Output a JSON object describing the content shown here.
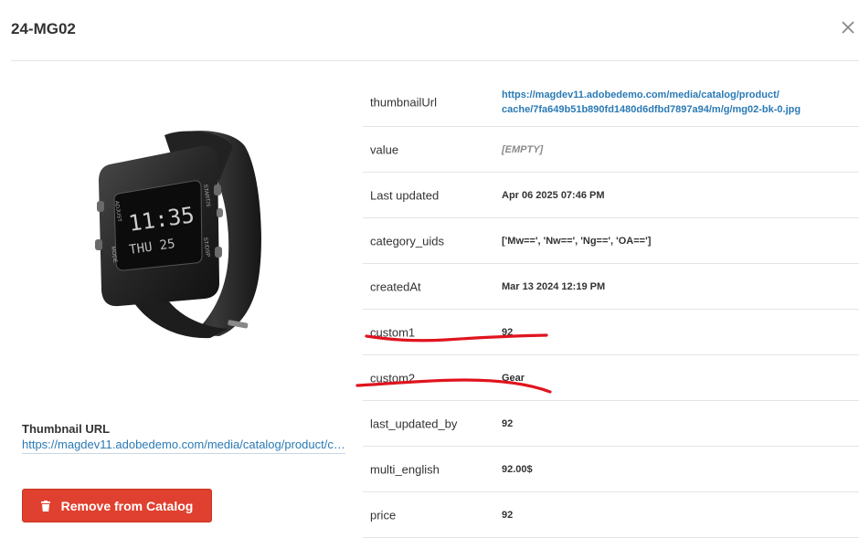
{
  "header": {
    "title": "24-MG02"
  },
  "thumbnail": {
    "label": "Thumbnail URL",
    "url": "https://magdev11.adobedemo.com/media/catalog/product/cache..."
  },
  "actions": {
    "remove_label": "Remove from Catalog"
  },
  "watch_display": {
    "time": "11:35",
    "day": "THU 25",
    "left_label": "ADJUST",
    "left_label2": "MODE",
    "right_label": "START/S",
    "right_label2": "ST/DSP"
  },
  "attributes": [
    {
      "key": "thumbnailUrl",
      "value_line1": "https://magdev11.adobedemo.com/media/catalog/product/",
      "value_line2": "cache/7fa649b51b890fd1480d6dfbd7897a94/m/g/mg02-bk-0.jpg"
    },
    {
      "key": "value",
      "value": "[EMPTY]"
    },
    {
      "key": "Last updated",
      "value": "Apr 06 2025 07:46 PM"
    },
    {
      "key": "category_uids",
      "value": "['Mw==', 'Nw==', 'Ng==', 'OA==']"
    },
    {
      "key": "createdAt",
      "value": "Mar 13 2024 12:19 PM"
    },
    {
      "key": "custom1",
      "value": "92"
    },
    {
      "key": "custom2",
      "value": "Gear"
    },
    {
      "key": "last_updated_by",
      "value": "92"
    },
    {
      "key": "multi_english",
      "value": "92.00$"
    },
    {
      "key": "price",
      "value": "92"
    }
  ],
  "colors": {
    "accent_link": "#2a7ab5",
    "danger": "#e0402f",
    "annotation": "#e0141e"
  },
  "icons": {
    "close": "close-icon",
    "remove": "trash-icon"
  }
}
